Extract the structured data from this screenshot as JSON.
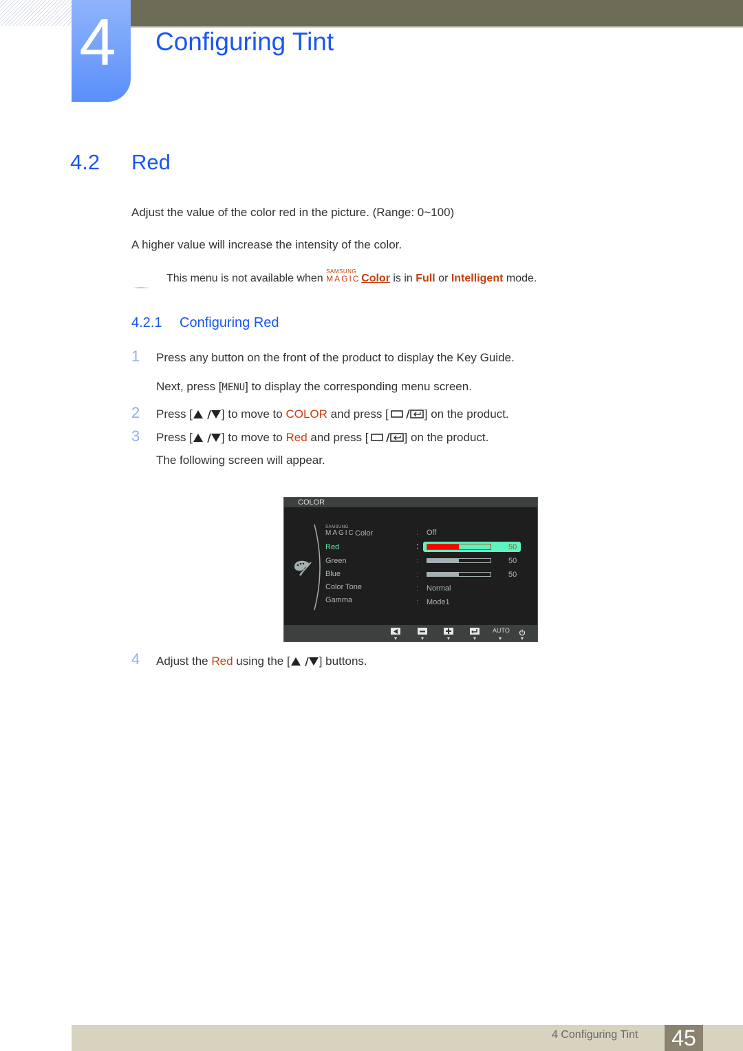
{
  "header": {
    "chapter_number": "4",
    "chapter_title": "Configuring Tint"
  },
  "section": {
    "number": "4.2",
    "title": "Red",
    "paragraphs": [
      "Adjust the value of the color red in the picture. (Range: 0~100)",
      "A higher value will increase the intensity of the color."
    ],
    "note": {
      "prefix": "This menu is not available when",
      "logo_top": "SAMSUNG",
      "logo_bottom": "MAGIC",
      "link": "Color",
      "middle": "is in",
      "mode1": "Full",
      "or": "or",
      "mode2": "Intelligent",
      "suffix": "mode."
    }
  },
  "subsection": {
    "number": "4.2.1",
    "title": "Configuring Red",
    "steps": [
      {
        "num": "1",
        "lines": [
          "Press any button on the front of the product to display the Key Guide."
        ],
        "next_prefix": "Next, press [",
        "next_key": "MENU",
        "next_suffix": "] to display the corresponding menu screen."
      },
      {
        "num": "2",
        "prefix": "Press [",
        "mid1": "] to move to",
        "target": "COLOR",
        "mid2": "and press [",
        "suffix": "] on the product."
      },
      {
        "num": "3",
        "prefix": "Press [",
        "mid1": "] to move to",
        "target": "Red",
        "mid2": "and press [",
        "suffix": "] on the product.",
        "after": "The following screen will appear."
      },
      {
        "num": "4",
        "prefix": "Adjust the",
        "target": "Red",
        "mid": "using the [",
        "suffix": "] buttons."
      }
    ]
  },
  "osd": {
    "header": "COLOR",
    "items": [
      {
        "label": "Color",
        "logo_top": "SAMSUNG",
        "logo_bottom": "MAGIC",
        "value": "Off"
      },
      {
        "label": "Red",
        "value_percent": 50,
        "number": "50",
        "selected": true
      },
      {
        "label": "Green",
        "value_percent": 50,
        "number": "50"
      },
      {
        "label": "Blue",
        "value_percent": 50,
        "number": "50"
      },
      {
        "label": "Color Tone",
        "value": "Normal"
      },
      {
        "label": "Gamma",
        "value": "Mode1"
      }
    ],
    "colon": ":",
    "footer_auto": "AUTO",
    "accent_selected": "#5ee5a8",
    "bar_red": "#ff0000"
  },
  "footer": {
    "label": "4 Configuring Tint",
    "page": "45"
  },
  "colors": {
    "heading_blue": "#1a56f0",
    "accent_orange": "#c53f0e",
    "top_bar": "#6d6c57",
    "footer_bar": "#d8d3bf",
    "page_box": "#8b8270"
  }
}
